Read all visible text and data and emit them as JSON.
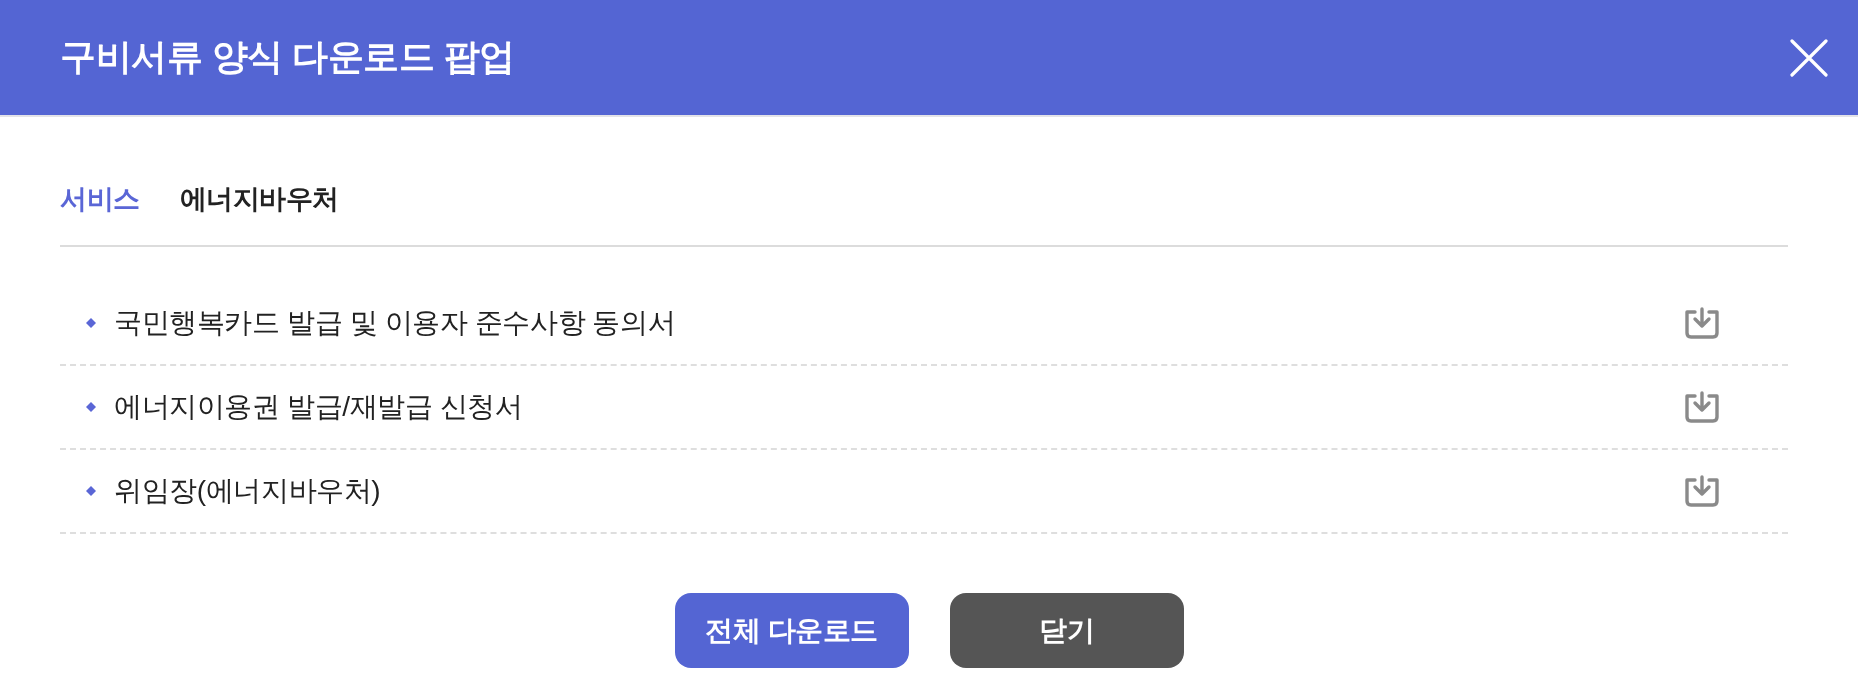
{
  "window": {
    "title": "구비서류 양식 다운로드 팝업"
  },
  "service": {
    "label": "서비스",
    "value": "에너지바우처"
  },
  "documents": [
    {
      "name": "국민행복카드 발급 및 이용자 준수사항 동의서"
    },
    {
      "name": "에너지이용권 발급/재발급 신청서"
    },
    {
      "name": "위임장(에너지바우처)"
    }
  ],
  "buttons": [
    {
      "label": "전체 다운로드",
      "kind": "primary"
    },
    {
      "label": "닫기",
      "kind": "secondary"
    }
  ]
}
